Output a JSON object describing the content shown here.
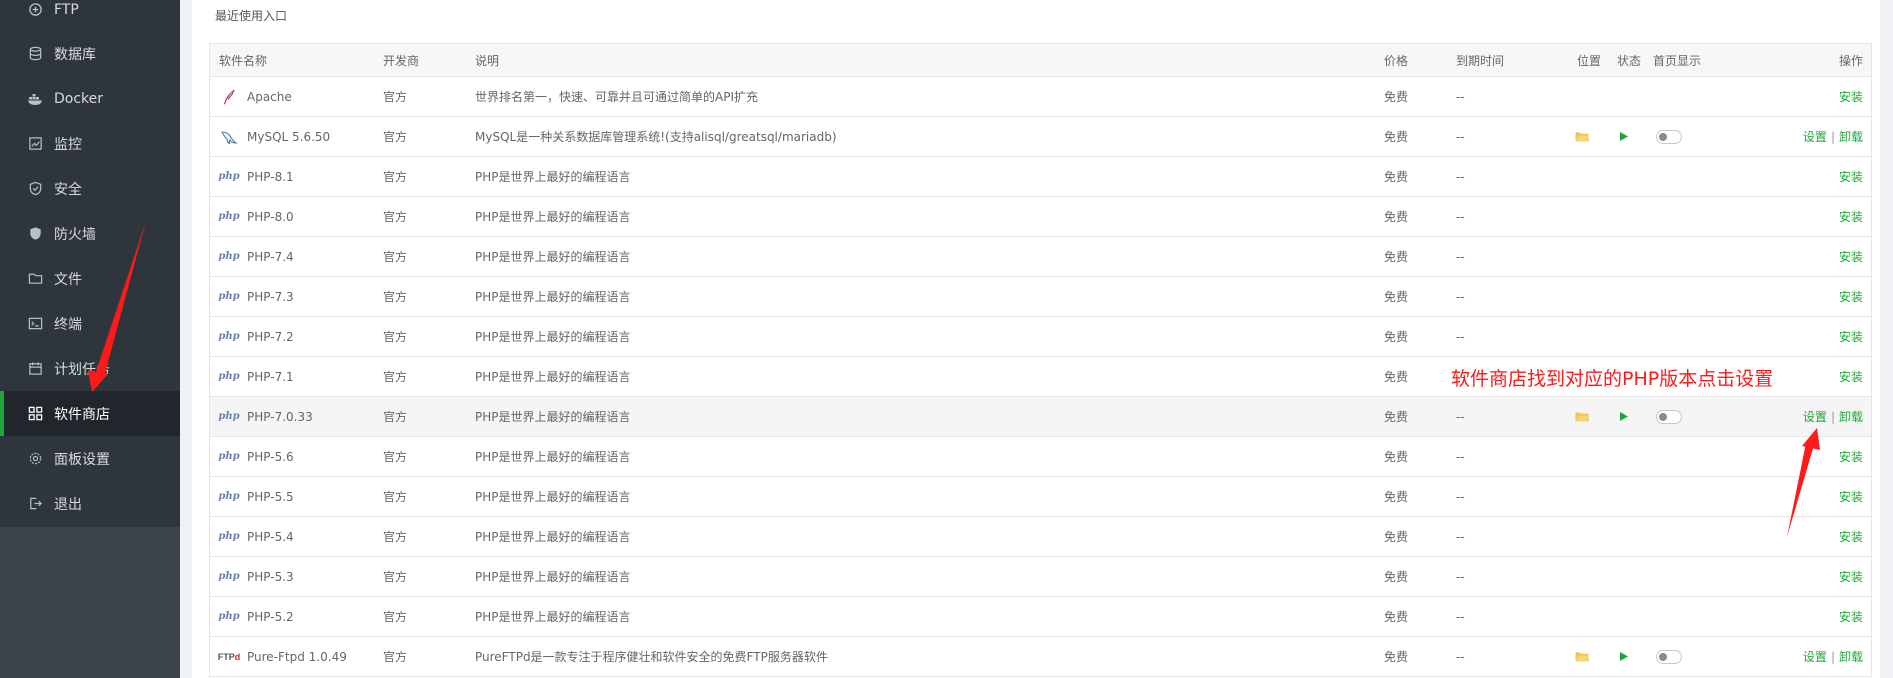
{
  "sidebar": {
    "items": [
      {
        "label": "FTP",
        "icon": "ftp-icon"
      },
      {
        "label": "数据库",
        "icon": "database-icon"
      },
      {
        "label": "Docker",
        "icon": "docker-icon"
      },
      {
        "label": "监控",
        "icon": "monitor-icon"
      },
      {
        "label": "安全",
        "icon": "shield-icon"
      },
      {
        "label": "防火墙",
        "icon": "firewall-icon"
      },
      {
        "label": "文件",
        "icon": "folder-icon"
      },
      {
        "label": "终端",
        "icon": "terminal-icon"
      },
      {
        "label": "计划任务",
        "icon": "calendar-icon"
      },
      {
        "label": "软件商店",
        "icon": "apps-icon",
        "active": true
      },
      {
        "label": "面板设置",
        "icon": "gear-icon"
      },
      {
        "label": "退出",
        "icon": "logout-icon"
      }
    ]
  },
  "main": {
    "recent_label": "最近使用入口",
    "table": {
      "headers": {
        "name": "软件名称",
        "developer": "开发商",
        "description": "说明",
        "price": "价格",
        "expiry": "到期时间",
        "location": "位置",
        "status": "状态",
        "homepage": "首页显示",
        "actions": "操作"
      },
      "rows": [
        {
          "name": "Apache",
          "icon": "apache-feather-icon",
          "developer": "官方",
          "description": "世界排名第一，快速、可靠并且可通过简单的API扩充",
          "price": "免费",
          "expiry": "--",
          "installed": false,
          "op": "安装"
        },
        {
          "name": "MySQL 5.6.50",
          "icon": "mysql-dolphin-icon",
          "developer": "官方",
          "description": "MySQL是一种关系数据库管理系统!(支持alisql/greatsql/mariadb)",
          "price": "免费",
          "expiry": "--",
          "installed": true,
          "op_set": "设置",
          "op_uninstall": "卸载"
        },
        {
          "name": "PHP-8.1",
          "icon": "php-icon",
          "developer": "官方",
          "description": "PHP是世界上最好的编程语言",
          "price": "免费",
          "expiry": "--",
          "installed": false,
          "op": "安装"
        },
        {
          "name": "PHP-8.0",
          "icon": "php-icon",
          "developer": "官方",
          "description": "PHP是世界上最好的编程语言",
          "price": "免费",
          "expiry": "--",
          "installed": false,
          "op": "安装"
        },
        {
          "name": "PHP-7.4",
          "icon": "php-icon",
          "developer": "官方",
          "description": "PHP是世界上最好的编程语言",
          "price": "免费",
          "expiry": "--",
          "installed": false,
          "op": "安装"
        },
        {
          "name": "PHP-7.3",
          "icon": "php-icon",
          "developer": "官方",
          "description": "PHP是世界上最好的编程语言",
          "price": "免费",
          "expiry": "--",
          "installed": false,
          "op": "安装"
        },
        {
          "name": "PHP-7.2",
          "icon": "php-icon",
          "developer": "官方",
          "description": "PHP是世界上最好的编程语言",
          "price": "免费",
          "expiry": "--",
          "installed": false,
          "op": "安装"
        },
        {
          "name": "PHP-7.1",
          "icon": "php-icon",
          "developer": "官方",
          "description": "PHP是世界上最好的编程语言",
          "price": "免费",
          "expiry": "--",
          "installed": false,
          "op": "安装"
        },
        {
          "name": "PHP-7.0.33",
          "icon": "php-icon",
          "developer": "官方",
          "description": "PHP是世界上最好的编程语言",
          "price": "免费",
          "expiry": "--",
          "installed": true,
          "highlight": true,
          "op_set": "设置",
          "op_uninstall": "卸载"
        },
        {
          "name": "PHP-5.6",
          "icon": "php-icon",
          "developer": "官方",
          "description": "PHP是世界上最好的编程语言",
          "price": "免费",
          "expiry": "--",
          "installed": false,
          "op": "安装"
        },
        {
          "name": "PHP-5.5",
          "icon": "php-icon",
          "developer": "官方",
          "description": "PHP是世界上最好的编程语言",
          "price": "免费",
          "expiry": "--",
          "installed": false,
          "op": "安装"
        },
        {
          "name": "PHP-5.4",
          "icon": "php-icon",
          "developer": "官方",
          "description": "PHP是世界上最好的编程语言",
          "price": "免费",
          "expiry": "--",
          "installed": false,
          "op": "安装"
        },
        {
          "name": "PHP-5.3",
          "icon": "php-icon",
          "developer": "官方",
          "description": "PHP是世界上最好的编程语言",
          "price": "免费",
          "expiry": "--",
          "installed": false,
          "op": "安装"
        },
        {
          "name": "PHP-5.2",
          "icon": "php-icon",
          "developer": "官方",
          "description": "PHP是世界上最好的编程语言",
          "price": "免费",
          "expiry": "--",
          "installed": false,
          "op": "安装"
        },
        {
          "name": "Pure-Ftpd 1.0.49",
          "icon": "ftp-logo-icon",
          "developer": "官方",
          "description": "PureFTPd是一款专注于程序健壮和软件安全的免费FTP服务器软件",
          "price": "免费",
          "expiry": "--",
          "installed": true,
          "op_set": "设置",
          "op_uninstall": "卸载"
        }
      ]
    }
  },
  "annotation": {
    "text": "软件商店找到对应的PHP版本点击设置",
    "color": "#ff1a1a"
  },
  "colors": {
    "accent": "#20a53a",
    "sidebar_bg": "#2f353c",
    "sidebar_active": "#20262c"
  }
}
